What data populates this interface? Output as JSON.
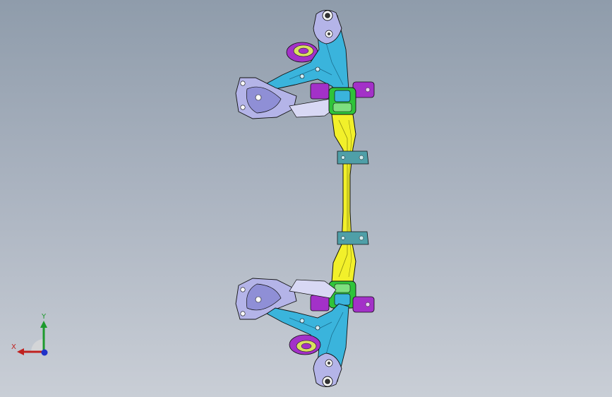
{
  "viewport": {
    "background_top": "#8f9cab",
    "background_bottom": "#c9ced6"
  },
  "model": {
    "colors": {
      "crossmember": "#f2f02a",
      "arm": "#3ab4dc",
      "mount": "#a331c8",
      "bushing": "#2fc43a",
      "bracket": "#b4b4e8",
      "bolt": "#4f9fa8",
      "outline": "#111111"
    }
  },
  "triad": {
    "x_label": "X",
    "y_label": "Y",
    "x_color": "#c0211f",
    "y_color": "#1d9a2d",
    "z_color": "#2032c8"
  }
}
